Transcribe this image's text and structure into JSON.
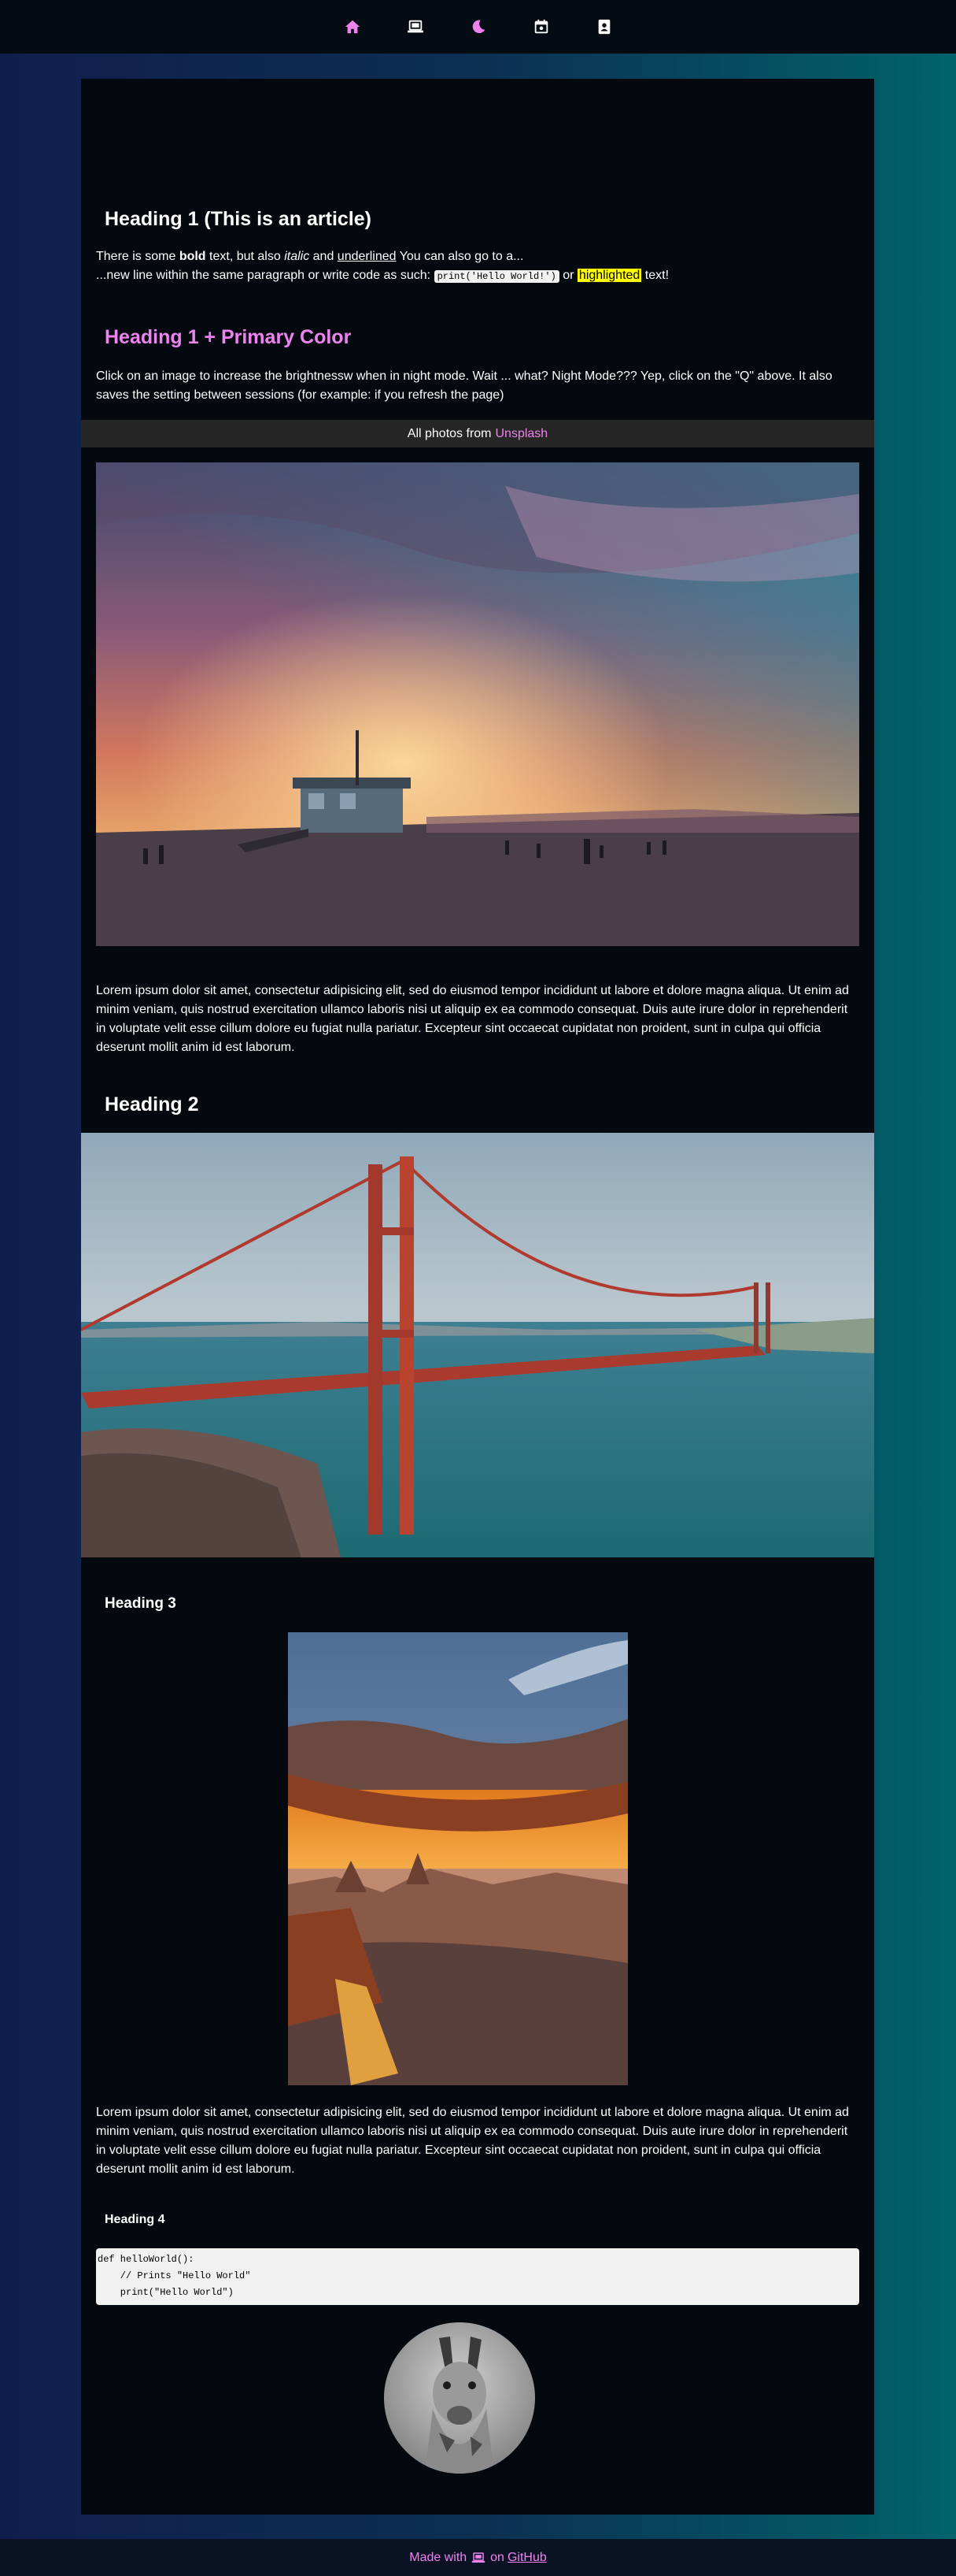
{
  "nav": {
    "icons": [
      "home-icon",
      "laptop-icon",
      "moon-icon",
      "calendar-icon",
      "contact-card-icon"
    ],
    "colors": {
      "home": "#ee82ee",
      "laptop": "#ffffff",
      "moon": "#ee82ee",
      "calendar": "#ffffff",
      "contact": "#ffffff"
    }
  },
  "article": {
    "heading1": "Heading 1 (This is an article)",
    "intro": {
      "p1": "There is some ",
      "bold": "bold",
      "p2": " text, but also ",
      "italic": "italic",
      "p3": " and ",
      "underlined": "underlined",
      "p4": " You can also go to a...",
      "p5": "...new line within the same paragraph or write code as such: ",
      "code": "print('Hello World!')",
      "p6": " or ",
      "highlighted": "highlighted",
      "p7": " text!"
    },
    "heading1_primary": "Heading 1 + Primary Color",
    "night_mode_text": "Click on an image to increase the brightnessw when in night mode. Wait ... what? Night Mode??? Yep, click on the \"Q\" above. It also saves the setting between sessions (for example: if you refresh the page)",
    "credit_prefix": "All photos from",
    "credit_link": "Unsplash",
    "lorem1": "Lorem ipsum dolor sit amet, consectetur adipisicing elit, sed do eiusmod tempor incididunt ut labore et dolore magna aliqua. Ut enim ad minim veniam, quis nostrud exercitation ullamco laboris nisi ut aliquip ex ea commodo consequat. Duis aute irure dolor in reprehenderit in voluptate velit esse cillum dolore eu fugiat nulla pariatur. Excepteur sint occaecat cupidatat non proident, sunt in culpa qui officia deserunt mollit anim id est laborum.",
    "heading2": "Heading 2",
    "heading3": "Heading 3",
    "lorem2": "Lorem ipsum dolor sit amet, consectetur adipisicing elit, sed do eiusmod tempor incididunt ut labore et dolore magna aliqua. Ut enim ad minim veniam, quis nostrud exercitation ullamco laboris nisi ut aliquip ex ea commodo consequat. Duis aute irure dolor in reprehenderit in voluptate velit esse cillum dolore eu fugiat nulla pariatur. Excepteur sint occaecat cupidatat non proident, sunt in culpa qui officia deserunt mollit anim id est laborum.",
    "heading4": "Heading 4",
    "code_lines": [
      "def helloWorld():",
      "    // Prints \"Hello World\"",
      "    print(\"Hello World\")"
    ]
  },
  "footer": {
    "prefix": "Made with",
    "icon": "laptop-icon",
    "on": "on",
    "link": "GitHub"
  },
  "colors": {
    "accent": "#ee82ee",
    "panel": "#03090f",
    "credit_bar": "#262626",
    "highlight": "#ffff00"
  }
}
